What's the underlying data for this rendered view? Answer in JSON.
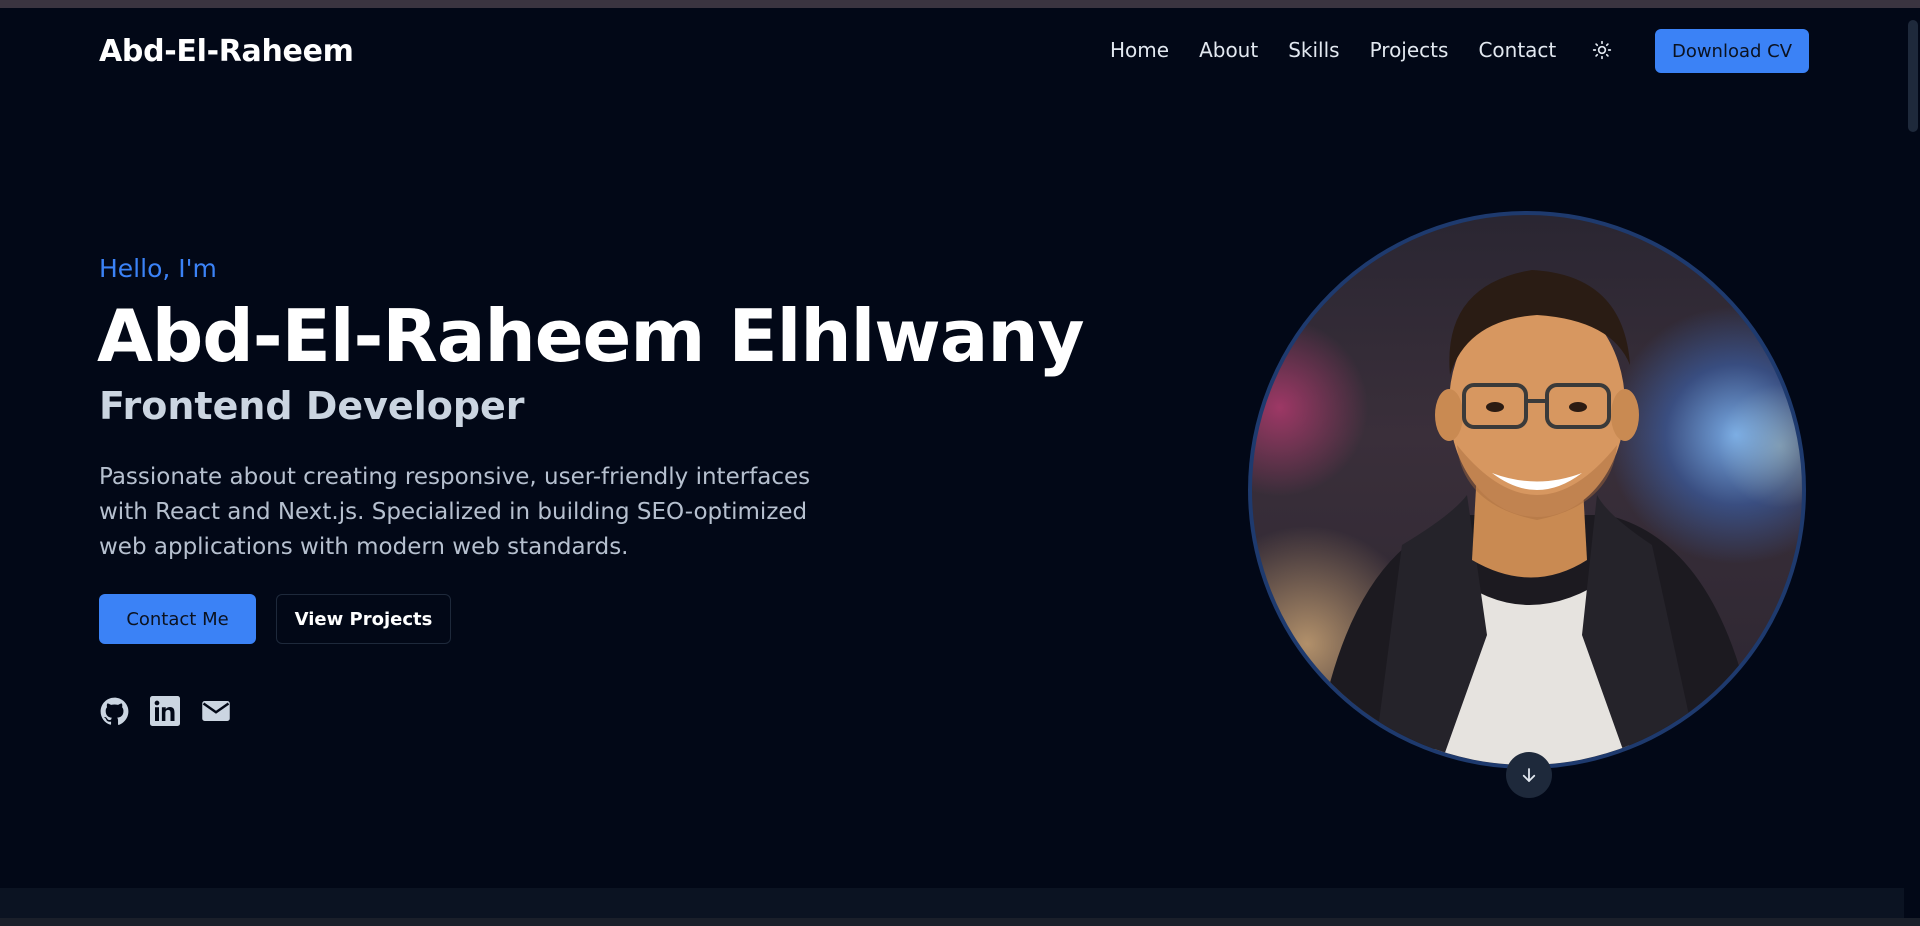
{
  "header": {
    "brand": "Abd-El-Raheem",
    "nav": [
      {
        "label": "Home"
      },
      {
        "label": "About"
      },
      {
        "label": "Skills"
      },
      {
        "label": "Projects"
      },
      {
        "label": "Contact"
      }
    ],
    "theme_icon": "sun-icon",
    "cv_label": "Download CV"
  },
  "hero": {
    "greeting": "Hello, I'm",
    "name": "Abd-El-Raheem Elhlwany",
    "role": "Frontend Developer",
    "bio": "Passionate about creating responsive, user-friendly interfaces with React and Next.js. Specialized in building SEO-optimized web applications with modern web standards.",
    "primary_button": "Contact Me",
    "secondary_button": "View Projects",
    "socials": [
      "github-icon",
      "linkedin-icon",
      "mail-icon"
    ],
    "portrait_icon": "profile-photo",
    "scroll_icon": "arrow-down-icon"
  },
  "colors": {
    "background": "#020817",
    "accent": "#3b82f6",
    "text": "#f8fafc",
    "muted": "#b6c0cf"
  }
}
